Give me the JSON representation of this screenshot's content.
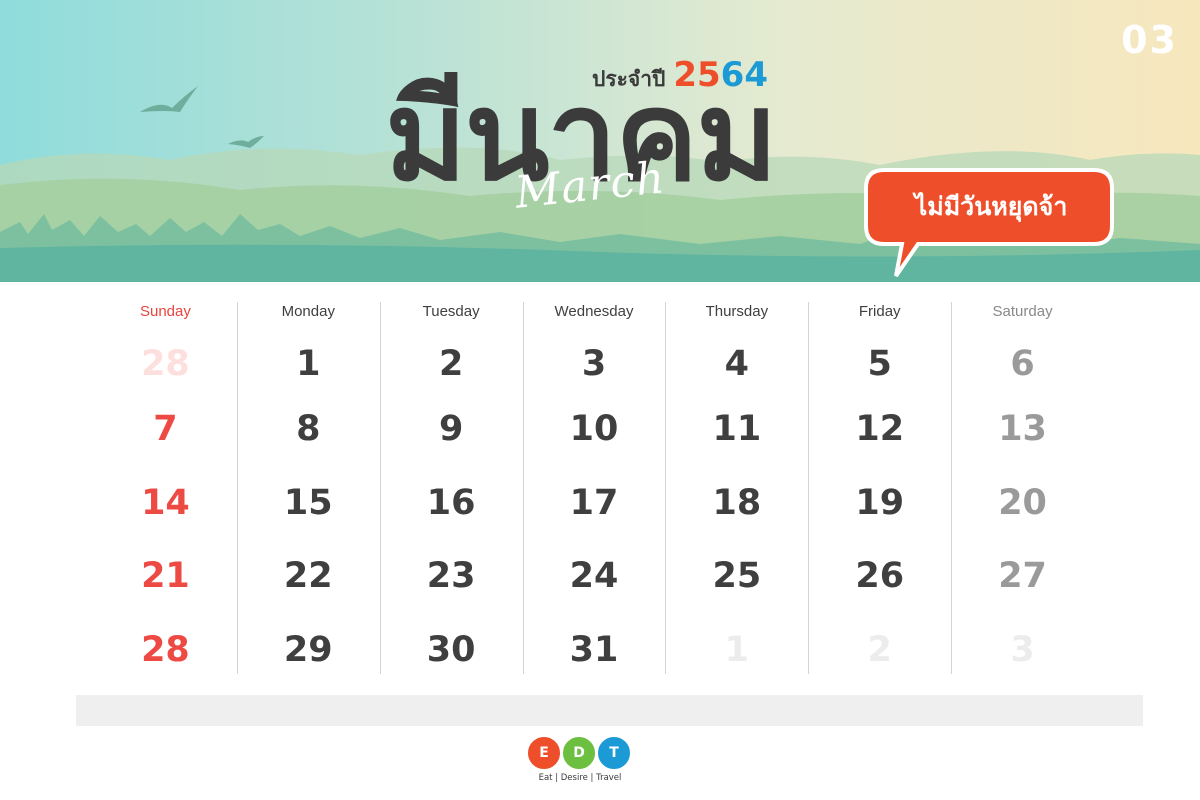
{
  "header": {
    "month_number": "03",
    "year_prefix": "ประจำปี",
    "year_part_a": "25",
    "year_part_b": "64",
    "month_thai": "มีนาคม",
    "month_english": "March",
    "holiday_note": "ไม่มีวันหยุดจ้า"
  },
  "calendar": {
    "weekdays": [
      "Sunday",
      "Monday",
      "Tuesday",
      "Wednesday",
      "Thursday",
      "Friday",
      "Saturday"
    ],
    "weeks": [
      [
        "28",
        "1",
        "2",
        "3",
        "4",
        "5",
        "6"
      ],
      [
        "7",
        "8",
        "9",
        "10",
        "11",
        "12",
        "13"
      ],
      [
        "14",
        "15",
        "16",
        "17",
        "18",
        "19",
        "20"
      ],
      [
        "21",
        "22",
        "23",
        "24",
        "25",
        "26",
        "27"
      ],
      [
        "28",
        "29",
        "30",
        "31",
        "1",
        "2",
        "3"
      ]
    ],
    "outside_month": [
      [
        0,
        0
      ],
      [
        4,
        4
      ],
      [
        4,
        5
      ],
      [
        4,
        6
      ]
    ]
  },
  "logo": {
    "letters": [
      "E",
      "D",
      "T"
    ],
    "circle_colors": [
      "#ee4f2a",
      "#6cbf3f",
      "#1b9ad6"
    ],
    "tagline": "Eat | Desire | Travel"
  },
  "colors": {
    "sunday": "#ee4a44",
    "saturday": "#9a9a9a",
    "weekday": "#3f3f3f",
    "accent_orange": "#ee4f2a",
    "accent_blue": "#1b9ad6"
  }
}
